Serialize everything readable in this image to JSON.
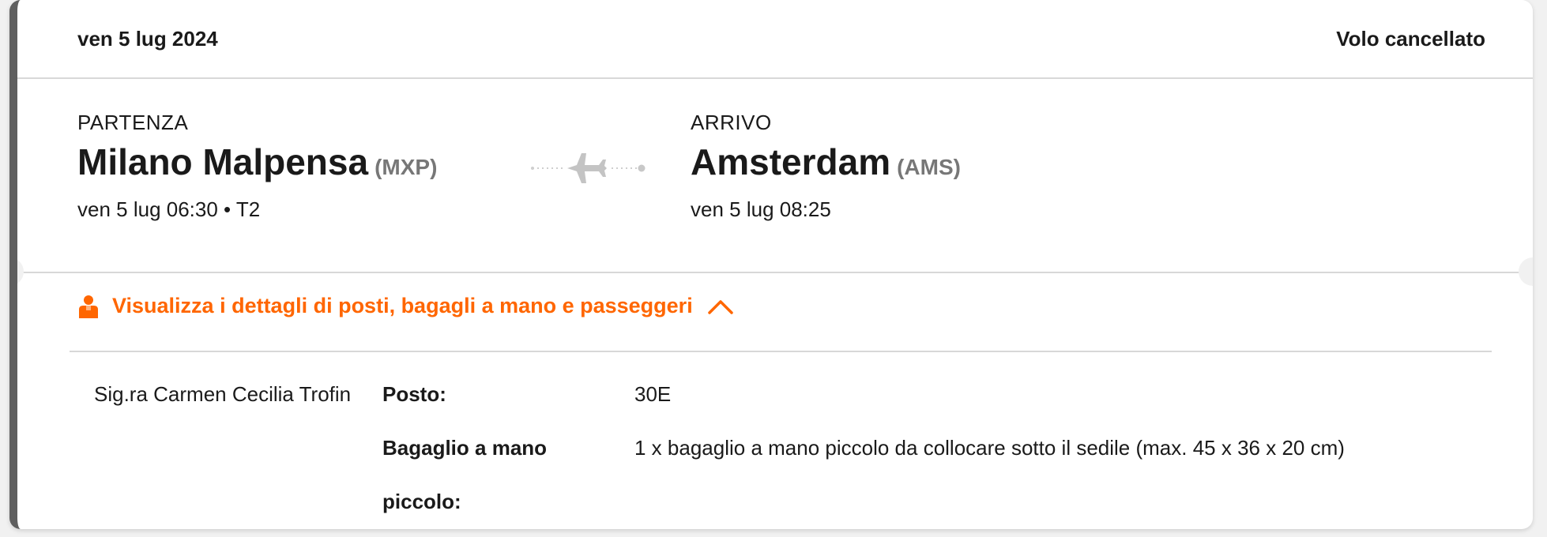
{
  "header": {
    "date": "ven 5 lug 2024",
    "status": "Volo cancellato"
  },
  "departure": {
    "label": "PARTENZA",
    "city": "Milano Malpensa",
    "code": "(MXP)",
    "time": "ven 5 lug 06:30 • T2"
  },
  "arrival": {
    "label": "ARRIVO",
    "city": "Amsterdam",
    "code": "(AMS)",
    "time": "ven 5 lug 08:25"
  },
  "details_toggle": {
    "label": "Visualizza i dettagli di posti, bagagli a mano e passeggeri",
    "icon": "person-icon",
    "chevron": "chevron-up-icon"
  },
  "passenger": {
    "name": "Sig.ra Carmen Cecilia Trofin",
    "seat_label": "Posto:",
    "seat_value": "30E",
    "bag_label_line1": "Bagaglio a mano",
    "bag_label_line2": "piccolo:",
    "bag_value": "1 x bagaglio a mano piccolo da collocare sotto il sedile (max. 45 x 36 x 20 cm)"
  },
  "colors": {
    "accent": "#ff6600",
    "card_border": "#5f5f5f",
    "code_gray": "#777777"
  }
}
